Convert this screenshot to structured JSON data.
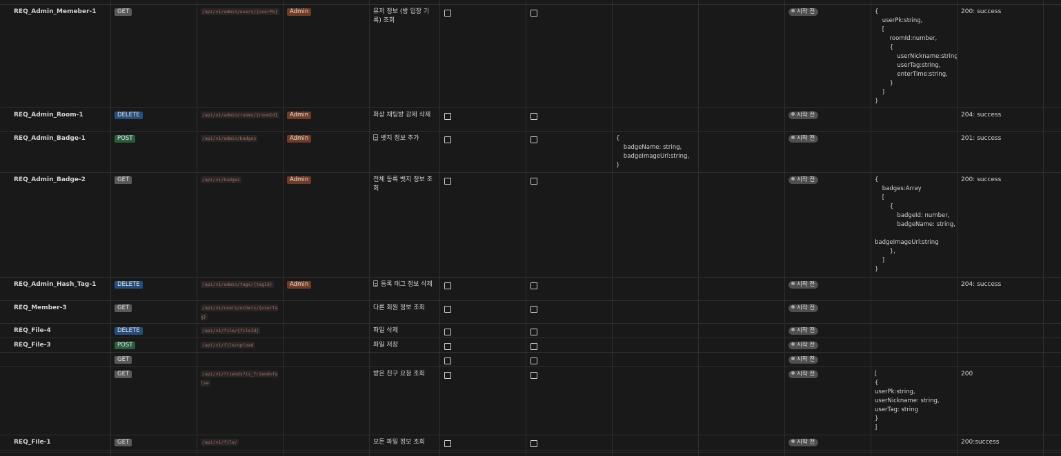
{
  "rows": [
    {
      "id": "REQ_Admin_Memeber-1",
      "method": "GET",
      "path": "/api/v1/admin/users/{userPk}",
      "role": "Admin",
      "title": "유저 정보 (방 입장 기록) 조회",
      "icon": "",
      "status": "시작 전",
      "request": "",
      "response": "{\n    userPk:string,\n    [\n        roomId:number,\n        {\n            userNickname:string,\n            userTag:string,\n            enterTime:string,\n        }\n    ]\n}",
      "code": "200: success"
    },
    {
      "id": "REQ_Admin_Room-1",
      "method": "DELETE",
      "path": "/api/v1/admin/rooms/{roomId}",
      "role": "Admin",
      "title": "화상 채팅방 강제 삭제",
      "icon": "",
      "status": "시작 전",
      "request": "",
      "response": "",
      "code": "204: success"
    },
    {
      "id": "REQ_Admin_Badge-1",
      "method": "POST",
      "path": "/api/v1/admin/badges",
      "role": "Admin",
      "title": "뱃지 정보 추가",
      "icon": "document-icon",
      "status": "시작 전",
      "request": "{\n    badgeName: string,\n    badgeImageUrl:string,\n}",
      "response": "",
      "code": "201: success"
    },
    {
      "id": "REQ_Admin_Badge-2",
      "method": "GET",
      "path": "/api/v1/badges",
      "role": "Admin",
      "title": "전체 등록 뱃지 정보 조회",
      "icon": "",
      "status": "시작 전",
      "request": "",
      "response": "{\n    badges:Array\n    [\n        {\n            badgeId: number,\n            badgeName: string,\n\nbadgeImageUrl:string\n        },\n    ]\n}",
      "code": "200: success"
    },
    {
      "id": "REQ_Admin_Hash_Tag-1",
      "method": "DELETE",
      "path": "/api/v1/admin/tags/{tagId}",
      "role": "Admin",
      "title": "등록 태그 정보 삭제",
      "icon": "document-icon",
      "status": "시작 전",
      "request": "",
      "response": "",
      "code": "204: success"
    },
    {
      "id": "REQ_Member-3",
      "method": "GET",
      "path": "/api/v1/users/others/{userTag}",
      "role": "",
      "title": "다른 회원 정보 조회",
      "icon": "",
      "status": "시작 전",
      "request": "",
      "response": "",
      "code": ""
    },
    {
      "id": "REQ_File-4",
      "method": "DELETE",
      "path": "/api/v1/file/{fileId}",
      "role": "",
      "title": "파일 삭제",
      "icon": "",
      "status": "시작 전",
      "request": "",
      "response": "",
      "code": ""
    },
    {
      "id": "REQ_File-3",
      "method": "POST",
      "path": "/api/v1/file/upload",
      "role": "",
      "title": "파일 저장",
      "icon": "",
      "status": "시작 전",
      "request": "",
      "response": "",
      "code": ""
    },
    {
      "id": "",
      "method": "GET",
      "path": "",
      "role": "",
      "title": "",
      "icon": "",
      "status": "시작 전",
      "request": "",
      "response": "",
      "code": ""
    },
    {
      "id": "",
      "method": "GET",
      "path": "/api/v1/friends?is_friend=false",
      "role": "",
      "title": "받은 친구 요청 조회",
      "icon": "",
      "status": "시작 전",
      "request": "",
      "response": "[\n{\nuserPk:string,\nuserNickname: string,\nuserTag: string\n}\n]",
      "code": "200"
    },
    {
      "id": "REQ_File-1",
      "method": "GET",
      "path": "/api/v1/file/",
      "role": "",
      "title": "모든 파일 정보 조회",
      "icon": "",
      "status": "시작 전",
      "request": "",
      "response": "",
      "code": "200:success"
    }
  ]
}
